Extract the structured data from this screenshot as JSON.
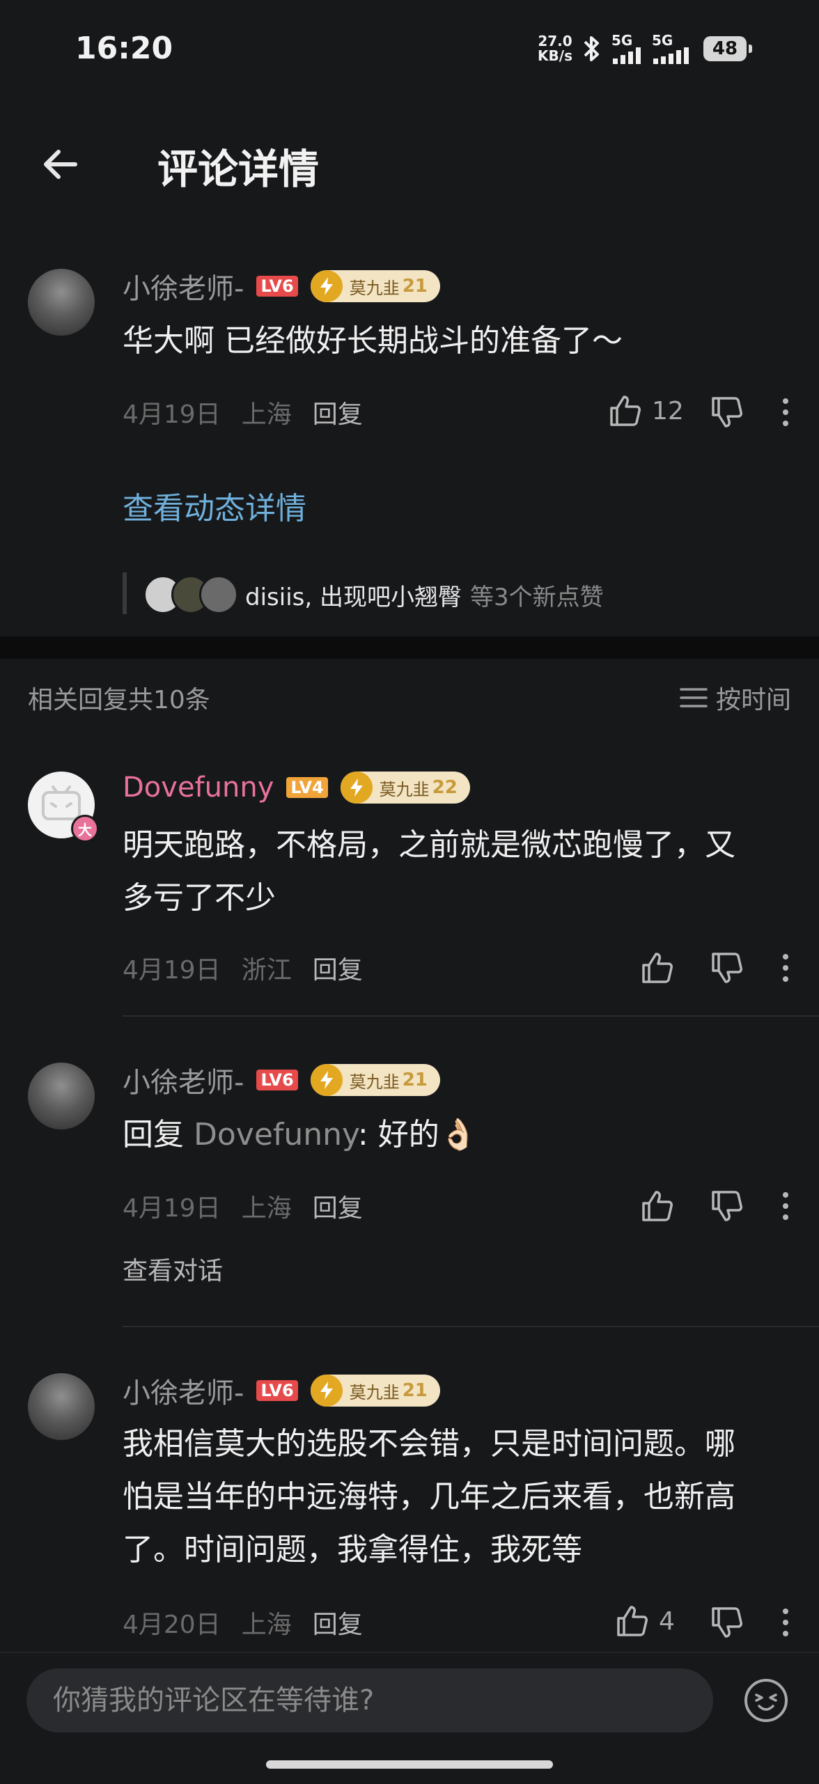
{
  "status_bar": {
    "time": "16:20",
    "net_speed_value": "27.0",
    "net_speed_unit": "KB/s",
    "sim1": "5G",
    "sim2": "5G",
    "battery": "48"
  },
  "header": {
    "title": "评论详情"
  },
  "main_comment": {
    "username": "小徐老师-",
    "level": "LV6",
    "fan_badge": {
      "name": "莫九韭",
      "level": "21"
    },
    "text": "华大啊 已经做好长期战斗的准备了～",
    "date": "4月19日",
    "location": "上海",
    "reply_label": "回复",
    "likes": "12",
    "view_detail": "查看动态详情",
    "likers_names": "disiis, 出现吧小翘臀",
    "likers_suffix": "等3个新点赞"
  },
  "related": {
    "count_label": "相关回复共10条",
    "sort_label": "按时间"
  },
  "replies": [
    {
      "username": "Dovefunny",
      "level": "LV4",
      "fan_badge": {
        "name": "莫九韭",
        "level": "22"
      },
      "avatar_badge": "大",
      "text_line1": "明天跑路，不格局，之前就是微芯跑慢了，又",
      "text_line2": "多亏了不少",
      "date": "4月19日",
      "location": "浙江",
      "reply_label": "回复"
    },
    {
      "username": "小徐老师-",
      "level": "LV6",
      "fan_badge": {
        "name": "莫九韭",
        "level": "21"
      },
      "reply_prefix": "回复",
      "reply_target": "Dovefunny",
      "text_after": ": 好的👌🏻",
      "date": "4月19日",
      "location": "上海",
      "reply_label": "回复",
      "view_convo": "查看对话"
    },
    {
      "username": "小徐老师-",
      "level": "LV6",
      "fan_badge": {
        "name": "莫九韭",
        "level": "21"
      },
      "text_line1": "我相信莫大的选股不会错，只是时间问题。哪",
      "text_line2": "怕是当年的中远海特，几年之后来看，也新高",
      "text_line3": "了。时间问题，我拿得住，我死等",
      "date": "4月20日",
      "location": "上海",
      "reply_label": "回复",
      "likes": "4"
    }
  ],
  "input": {
    "placeholder": "你猜我的评论区在等待谁?"
  },
  "icons": {
    "back": "arrow-left-icon",
    "like": "thumb-up-icon",
    "dislike": "thumb-down-icon",
    "more": "more-vertical-icon",
    "sort": "sort-lines-icon",
    "emoji": "emoji-icon",
    "bolt": "lightning-icon"
  },
  "colors": {
    "background": "#17181a",
    "link_blue": "#6fb0dc",
    "pink_username": "#e8729a",
    "lv6_red": "#e64a4a",
    "lv4_orange": "#f0a43a",
    "fan_badge_bg": "#f3e4c4"
  }
}
